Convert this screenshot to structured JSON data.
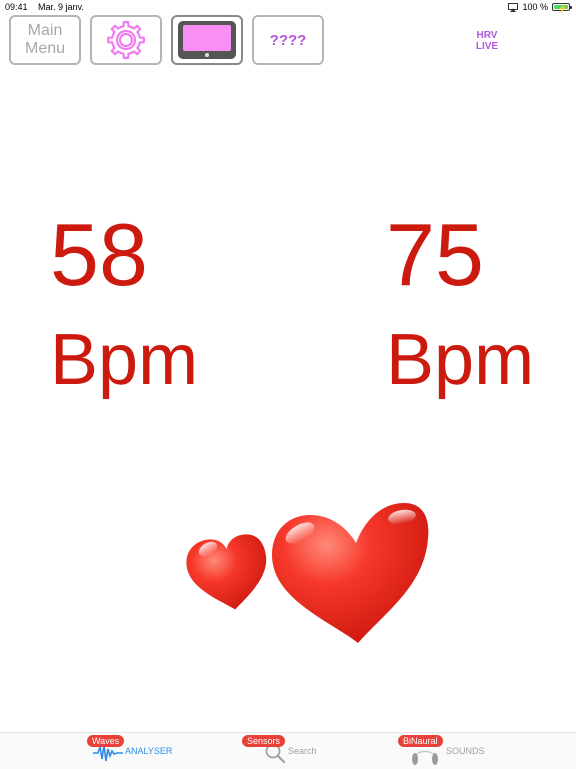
{
  "status_bar": {
    "time": "09:41",
    "date": "Mar. 9 janv.",
    "battery": "100 %",
    "battery_level": 1.0
  },
  "toolbar": {
    "main_menu_label": "Main\nMenu",
    "settings_icon": "gear-icon",
    "display_icon": "tablet-icon",
    "help_label": "????",
    "hrv_label": "HRV\nLIVE"
  },
  "readings": {
    "left_value": "58",
    "left_unit": "Bpm",
    "right_value": "75",
    "right_unit": "Bpm"
  },
  "tabbar": {
    "tabs": [
      {
        "badge": "Waves",
        "label": "ANALYSER",
        "icon": "waveform-icon",
        "active": true
      },
      {
        "badge": "Sensors",
        "label": "Search",
        "icon": "search-icon",
        "active": false
      },
      {
        "badge": "BiNaural",
        "label": "SOUNDS",
        "icon": "headphones-icon",
        "active": false
      }
    ]
  },
  "colors": {
    "bpm": "#cc1a0f",
    "accent_purple": "#b455e0",
    "tab_active": "#2e8de8",
    "badge": "#e8413a"
  }
}
